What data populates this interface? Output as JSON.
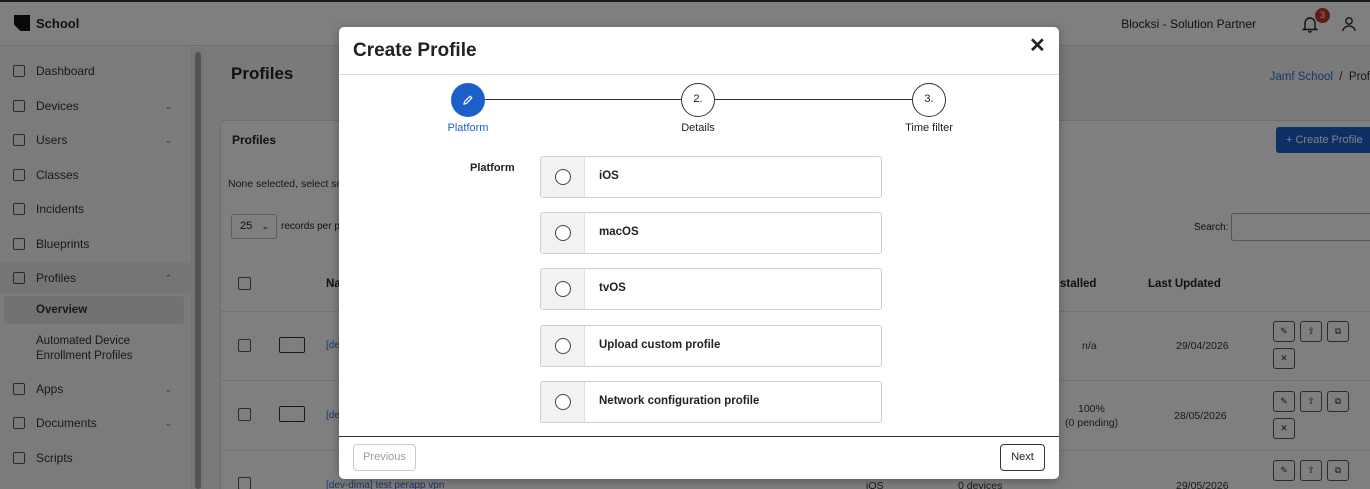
{
  "app": {
    "brand": "School",
    "partner": "Blocksi - Solution Partner",
    "notification_count": "3"
  },
  "sidebar": {
    "items": [
      {
        "label": "Dashboard",
        "icon": "grid-icon"
      },
      {
        "label": "Devices",
        "icon": "monitor-icon"
      },
      {
        "label": "Users",
        "icon": "users-icon"
      },
      {
        "label": "Classes",
        "icon": "book-icon"
      },
      {
        "label": "Incidents",
        "icon": "pin-icon"
      },
      {
        "label": "Blueprints",
        "icon": "sliders-icon"
      },
      {
        "label": "Profiles",
        "icon": "layers-icon"
      },
      {
        "label": "Apps",
        "icon": "apps-icon"
      },
      {
        "label": "Documents",
        "icon": "document-icon"
      },
      {
        "label": "Scripts",
        "icon": "script-icon"
      }
    ],
    "sub_items": [
      "Overview",
      "Automated Device Enrollment Profiles"
    ]
  },
  "page": {
    "title": "Profiles",
    "breadcrumb_root": "Jamf School",
    "breadcrumb_sep": "/",
    "breadcrumb_current": "Prof",
    "card_title": "Profiles",
    "create_button": "+ Create Profile",
    "none_selected": "None selected, select so",
    "per_page_value": "25",
    "per_page_text": "records per p",
    "search_label": "Search:",
    "columns": {
      "name": "Na",
      "installed": "stalled",
      "last_updated": "Last Updated"
    },
    "rows": [
      {
        "name": "[dev",
        "installed": "n/a",
        "installed_sub": "",
        "last_updated": "29/04/2026"
      },
      {
        "name": "[de",
        "installed": "100%",
        "installed_sub": "(0 pending)",
        "last_updated": "28/05/2026"
      },
      {
        "name": "[dev-dima] test perapp vpn",
        "platform": "iOS",
        "installed": "0 devices",
        "installed_sub": "",
        "last_updated": "29/05/2026"
      }
    ]
  },
  "modal": {
    "title": "Create Profile",
    "close_label": "✕",
    "steps": [
      {
        "number": "",
        "label": "Platform",
        "active": true
      },
      {
        "number": "2.",
        "label": "Details",
        "active": false
      },
      {
        "number": "3.",
        "label": "Time filter",
        "active": false
      }
    ],
    "platform_label": "Platform",
    "options": [
      "iOS",
      "macOS",
      "tvOS",
      "Upload custom profile",
      "Network configuration profile"
    ],
    "previous_label": "Previous",
    "next_label": "Next"
  },
  "colors": {
    "accent": "#1d5fc8",
    "badge": "#c0392b",
    "link": "#2c6cd6"
  }
}
